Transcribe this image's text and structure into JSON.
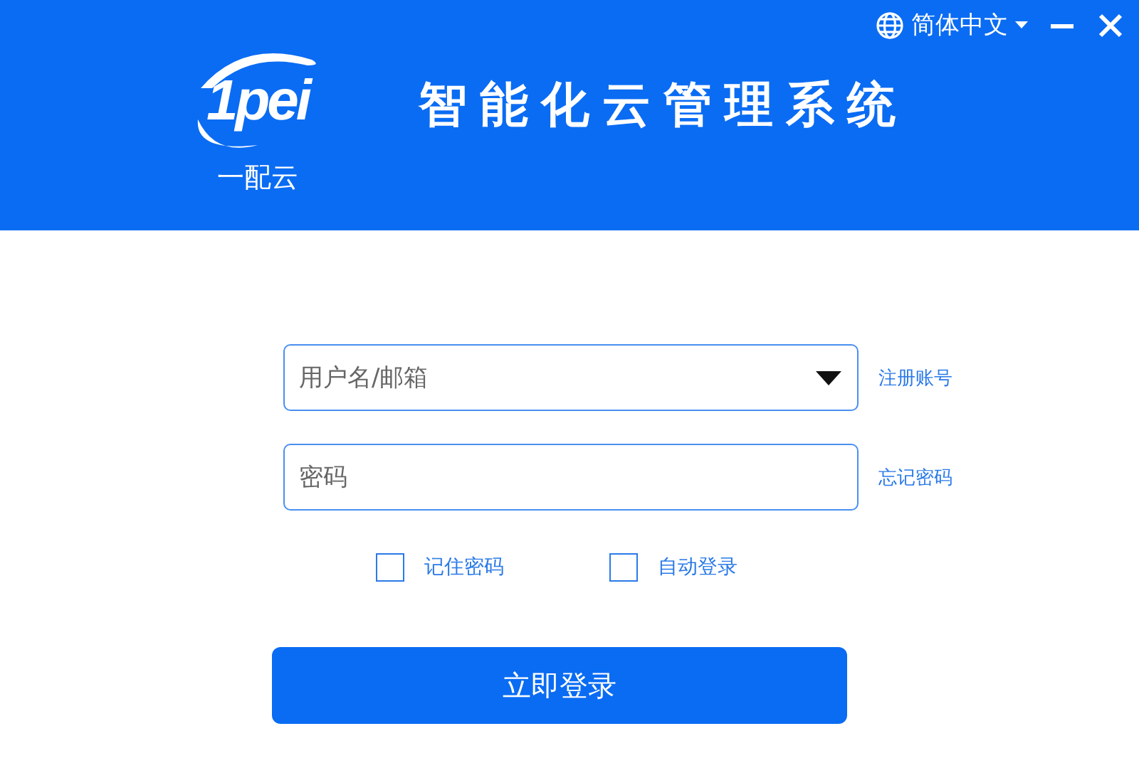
{
  "header": {
    "logo_mark": "1pei",
    "logo_caption": "一配云",
    "title": "智能化云管理系统",
    "language": "简体中文"
  },
  "form": {
    "username": {
      "placeholder": "用户名/邮箱"
    },
    "register_link": "注册账号",
    "password": {
      "placeholder": "密码"
    },
    "forgot_link": "忘记密码",
    "options": [
      {
        "label": "记住密码",
        "checked": false
      },
      {
        "label": "自动登录",
        "checked": false
      }
    ],
    "submit": "立即登录"
  }
}
